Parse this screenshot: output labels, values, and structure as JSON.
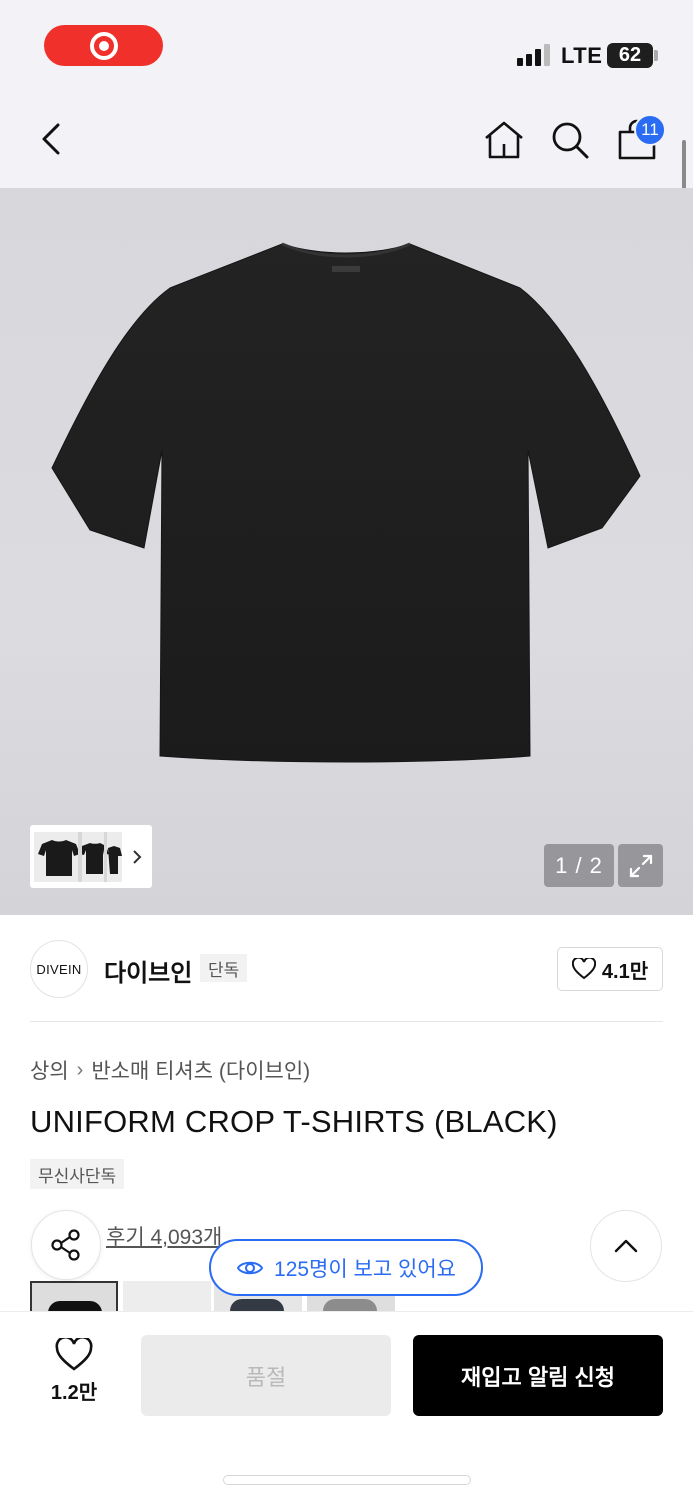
{
  "status_bar": {
    "network": "LTE",
    "battery": "62"
  },
  "nav": {
    "cart_count": "11",
    "icons": [
      "back-icon",
      "home-icon",
      "search-icon",
      "shopping-bag-icon"
    ]
  },
  "product_image": {
    "page_counter": "1 / 2",
    "icons": [
      "chevron-right-icon",
      "expand-icon"
    ]
  },
  "brand": {
    "logo_text": "DIVEIN",
    "name": "다이브인",
    "tag": "단독",
    "likes": "4.1만"
  },
  "breadcrumb": {
    "category": "상의",
    "subcategory": "반소매 티셔츠 (다이브인)"
  },
  "product": {
    "title": "UNIFORM CROP T-SHIRTS (BLACK)",
    "exclusive_tag": "무신사단독",
    "reviews": "후기 4,093개",
    "viewers": "125명이 보고 있어요"
  },
  "bottom_bar": {
    "wish_count": "1.2만",
    "soldout_label": "품절",
    "restock_label": "재입고 알림 신청"
  },
  "colors": {
    "accent_blue": "#2a6cf3",
    "record_red": "#f0302a",
    "cta_black": "#000000"
  }
}
